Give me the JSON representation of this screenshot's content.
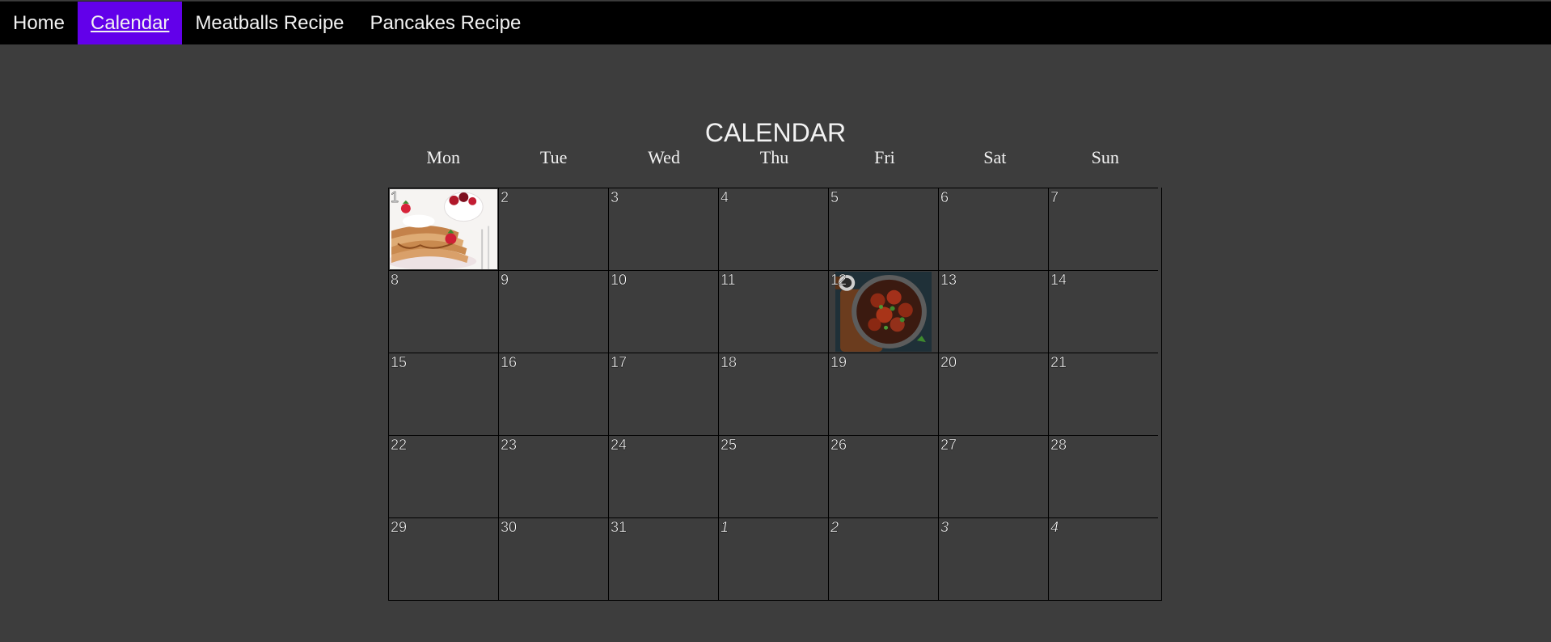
{
  "nav": {
    "items": [
      {
        "label": "Home",
        "active": false
      },
      {
        "label": "Calendar",
        "active": true
      },
      {
        "label": "Meatballs Recipe",
        "active": false
      },
      {
        "label": "Pancakes Recipe",
        "active": false
      }
    ],
    "active_color": "#6200ea"
  },
  "calendar": {
    "title": "CALENDAR",
    "weekdays": [
      "Mon",
      "Tue",
      "Wed",
      "Thu",
      "Fri",
      "Sat",
      "Sun"
    ],
    "days": [
      {
        "num": "1",
        "current_month": true,
        "image": "pancakes-photo"
      },
      {
        "num": "2",
        "current_month": true
      },
      {
        "num": "3",
        "current_month": true
      },
      {
        "num": "4",
        "current_month": true
      },
      {
        "num": "5",
        "current_month": true
      },
      {
        "num": "6",
        "current_month": true
      },
      {
        "num": "7",
        "current_month": true
      },
      {
        "num": "8",
        "current_month": true
      },
      {
        "num": "9",
        "current_month": true
      },
      {
        "num": "10",
        "current_month": true
      },
      {
        "num": "11",
        "current_month": true
      },
      {
        "num": "12",
        "current_month": true,
        "image": "meatballs-photo"
      },
      {
        "num": "13",
        "current_month": true
      },
      {
        "num": "14",
        "current_month": true
      },
      {
        "num": "15",
        "current_month": true
      },
      {
        "num": "16",
        "current_month": true
      },
      {
        "num": "17",
        "current_month": true
      },
      {
        "num": "18",
        "current_month": true
      },
      {
        "num": "19",
        "current_month": true
      },
      {
        "num": "20",
        "current_month": true
      },
      {
        "num": "21",
        "current_month": true
      },
      {
        "num": "22",
        "current_month": true
      },
      {
        "num": "23",
        "current_month": true
      },
      {
        "num": "24",
        "current_month": true
      },
      {
        "num": "25",
        "current_month": true
      },
      {
        "num": "26",
        "current_month": true
      },
      {
        "num": "27",
        "current_month": true
      },
      {
        "num": "28",
        "current_month": true
      },
      {
        "num": "29",
        "current_month": true
      },
      {
        "num": "30",
        "current_month": true
      },
      {
        "num": "31",
        "current_month": true
      },
      {
        "num": "1",
        "current_month": false
      },
      {
        "num": "2",
        "current_month": false
      },
      {
        "num": "3",
        "current_month": false
      },
      {
        "num": "4",
        "current_month": false
      }
    ]
  }
}
